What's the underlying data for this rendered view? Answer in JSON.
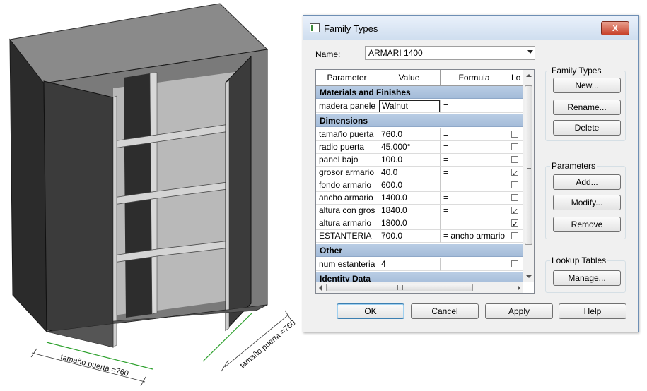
{
  "model": {
    "dimensions": [
      {
        "label": "tamaño puerta =760"
      },
      {
        "label": "tamaño puerta =760"
      }
    ]
  },
  "dialog": {
    "title": "Family Types",
    "close_label": "X",
    "name_label": "Name:",
    "name_value": "ARMARI 1400",
    "table": {
      "headers": [
        "Parameter",
        "Value",
        "Formula",
        "Lo"
      ],
      "groups": [
        {
          "label": "Materials and Finishes",
          "rows": [
            {
              "param": "madera panele",
              "value": "Walnut",
              "formula": "=",
              "lock": null,
              "editing": true
            }
          ]
        },
        {
          "label": "Dimensions",
          "rows": [
            {
              "param": "tamaño puerta",
              "value": "760.0",
              "formula": "=",
              "lock": false
            },
            {
              "param": "radio puerta",
              "value": "45.000°",
              "formula": "=",
              "lock": false
            },
            {
              "param": "panel bajo",
              "value": "100.0",
              "formula": "=",
              "lock": false
            },
            {
              "param": "grosor armario",
              "value": "40.0",
              "formula": "=",
              "lock": true
            },
            {
              "param": "fondo armario",
              "value": "600.0",
              "formula": "=",
              "lock": false
            },
            {
              "param": "ancho armario",
              "value": "1400.0",
              "formula": "=",
              "lock": false
            },
            {
              "param": "altura con gros",
              "value": "1840.0",
              "formula": "=",
              "lock": true
            },
            {
              "param": "altura armario",
              "value": "1800.0",
              "formula": "=",
              "lock": true
            },
            {
              "param": "ESTANTERIA",
              "value": "700.0",
              "formula": "= ancho armario",
              "lock": false
            }
          ]
        },
        {
          "label": "Other",
          "rows": [
            {
              "param": "num estanteria",
              "value": "4",
              "formula": "=",
              "lock": false
            }
          ]
        },
        {
          "label": "Identity Data",
          "rows": []
        }
      ]
    },
    "family_types": {
      "title": "Family Types",
      "new": "New...",
      "rename": "Rename...",
      "delete": "Delete"
    },
    "parameters": {
      "title": "Parameters",
      "add": "Add...",
      "modify": "Modify...",
      "remove": "Remove"
    },
    "lookup": {
      "title": "Lookup Tables",
      "manage": "Manage..."
    },
    "footer": {
      "ok": "OK",
      "cancel": "Cancel",
      "apply": "Apply",
      "help": "Help"
    }
  }
}
